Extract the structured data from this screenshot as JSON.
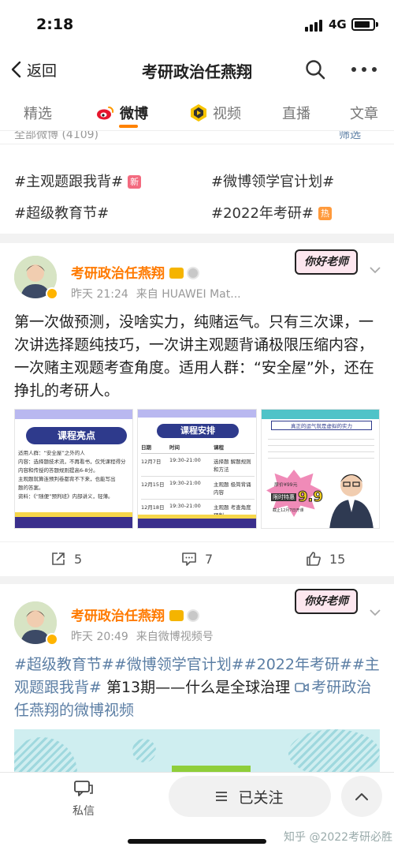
{
  "status": {
    "time": "2:18",
    "network": "4G"
  },
  "nav": {
    "back_label": "返回",
    "title": "考研政治任燕翔"
  },
  "tabs": [
    {
      "label": "精选"
    },
    {
      "label": "微博"
    },
    {
      "label": "视频"
    },
    {
      "label": "直播"
    },
    {
      "label": "文章"
    }
  ],
  "topics_card": {
    "all_label": "全部微博 (4109)",
    "filter_label": "筛选",
    "topics": [
      {
        "text": "#主观题跟我背#",
        "badge": "新"
      },
      {
        "text": "#微博领学官计划#",
        "badge": ""
      },
      {
        "text": "#超级教育节#",
        "badge": ""
      },
      {
        "text": "#2022年考研#",
        "badge": "热"
      }
    ]
  },
  "posts": [
    {
      "username": "考研政治任燕翔",
      "time": "昨天 21:24",
      "source": "来自 HUAWEI Mat...",
      "sticker": "你好老师",
      "text": "第一次做预测，没啥实力，纯赌运气。只有三次课，一次讲选择题纯技巧，一次讲主观题背诵极限压缩内容，一次赌主观题考查角度。适用人群：“安全屋”外，还在挣扎的考研人。",
      "images": [
        {
          "title": "课程亮点",
          "lines": [
            "适用人群：“安全屋”之外的人",
            "内容：选择题技术流，不再看书，仅凭课程得分",
            "内容和传授的答题规则提高6-8分。",
            "主观题就算连预判卷都背不下来，也能写出",
            "题的答案。",
            "资料：《“随便”预判班》内部讲义，轻薄。"
          ]
        },
        {
          "title": "课程安排",
          "header": [
            "日期",
            "时间",
            "课程"
          ],
          "rows": [
            [
              "12月7日",
              "19:30-21:00",
              "选择题 解题规则和方法"
            ],
            [
              "12月15日",
              "19:30-21:00",
              "主观题 极简背诵内容"
            ],
            [
              "12月18日",
              "19:30-21:00",
              "主观题 考查角度预判"
            ]
          ]
        },
        {
          "banner": "真正的运气就是虚拟的实力",
          "price_old": "原价¥99元",
          "price_label": "限时特惠",
          "price": "9.9",
          "price_note": "截止12月7日开课"
        }
      ],
      "actions": {
        "share": "5",
        "comment": "7",
        "like": "15"
      }
    },
    {
      "username": "考研政治任燕翔",
      "time": "昨天 20:49",
      "source": "来自微博视频号",
      "sticker": "你好老师",
      "text_parts": [
        {
          "text": "#超级教育节##微博领学官计划##2022年考研##主观题跟我背#",
          "link": true
        },
        {
          "text": " 第13期——什么是全球治理 ",
          "link": false
        },
        {
          "text": "考研政治任燕翔的微博视频",
          "link": true
        }
      ]
    }
  ],
  "bottom": {
    "dm_label": "私信",
    "follow_label": "已关注",
    "watermark": "知乎 @2022考研必胜"
  },
  "colors": {
    "accent": "#ff8200",
    "link": "#5b7ea4",
    "username": "#ff7a00"
  }
}
